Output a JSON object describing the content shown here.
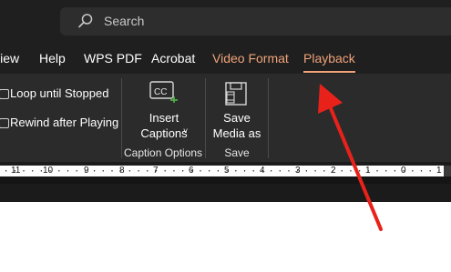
{
  "search": {
    "placeholder": "Search",
    "icon": "search-icon"
  },
  "tabs": [
    {
      "label": "View"
    },
    {
      "label": "Help"
    },
    {
      "label": "WPS PDF"
    },
    {
      "label": "Acrobat"
    },
    {
      "label": "Video Format"
    },
    {
      "label": "Playback"
    }
  ],
  "ribbon": {
    "checkboxes": [
      {
        "label": "Loop until Stopped",
        "checked": false
      },
      {
        "label": "Rewind after Playing",
        "checked": false
      }
    ],
    "insert_captions": {
      "line1": "Insert",
      "line2": "Captions",
      "icon": "cc-icon"
    },
    "caption_group_label": "Caption Options",
    "save_media": {
      "line1": "Save",
      "line2": "Media as",
      "icon": "film-save-icon"
    },
    "save_group_label": "Save"
  },
  "ruler": {
    "ticks": [
      "11",
      "10",
      "9",
      "8",
      "7",
      "6",
      "5",
      "4",
      "3",
      "2",
      "1",
      "0",
      "1"
    ]
  },
  "colors": {
    "accent": "#f0a37a",
    "annotation_arrow": "#e8221b",
    "ribbon_bg": "#2b2b2b",
    "titlebar_bg": "#1f1f1f"
  }
}
